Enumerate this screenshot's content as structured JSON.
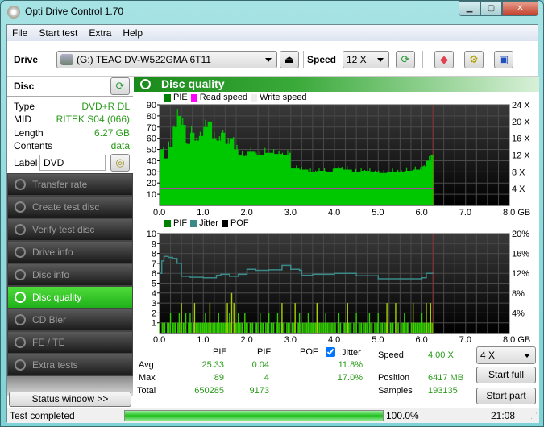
{
  "window": {
    "title": "Opti Drive Control 1.70",
    "minimize": "▁",
    "maximize": "▢",
    "close": "✕"
  },
  "menu": [
    "File",
    "Start test",
    "Extra",
    "Help"
  ],
  "toolbar": {
    "drive_label": "Drive",
    "drive_value": "(G:)  TEAC DV-W522GMA 6T11",
    "speed_label": "Speed",
    "speed_value": "12 X"
  },
  "disc": {
    "title": "Disc",
    "type_label": "Type",
    "type": "DVD+R DL",
    "mid_label": "MID",
    "mid": "RITEK S04 (066)",
    "length_label": "Length",
    "length": "6.27 GB",
    "contents_label": "Contents",
    "contents": "data",
    "label_label": "Label",
    "label": "DVD"
  },
  "nav": [
    "Transfer rate",
    "Create test disc",
    "Verify test disc",
    "Drive info",
    "Disc info",
    "Disc quality",
    "CD Bler",
    "FE / TE",
    "Extra tests"
  ],
  "nav_active": 5,
  "status_window": "Status window >>",
  "panel_title": "Disc quality",
  "colors": {
    "pie": "#00c800",
    "pif": "#33cc00",
    "jitter": "#3a8a8a",
    "read_speed": "#ff00ff",
    "end_marker": "#ff0000"
  },
  "chart_data": [
    {
      "type": "bar",
      "title": "PIE",
      "legend": [
        "PIE",
        "Read speed",
        "Write speed"
      ],
      "xlabel": "GB",
      "xlim": [
        0,
        8
      ],
      "xticks": [
        "0.0",
        "1.0",
        "2.0",
        "3.0",
        "4.0",
        "5.0",
        "6.0",
        "7.0",
        "8.0 GB"
      ],
      "ylim": [
        0,
        90
      ],
      "yticks": [
        "10",
        "20",
        "30",
        "40",
        "50",
        "60",
        "70",
        "80",
        "90"
      ],
      "y2ticks": [
        "4 X",
        "8 X",
        "12 X",
        "16 X",
        "20 X",
        "24 X"
      ],
      "y2lim": [
        0,
        24
      ],
      "x": [
        0,
        0.1,
        0.2,
        0.3,
        0.4,
        0.5,
        0.6,
        0.7,
        0.8,
        0.9,
        1.0,
        1.1,
        1.2,
        1.3,
        1.4,
        1.5,
        1.6,
        1.7,
        1.8,
        1.9,
        2.0,
        2.2,
        2.4,
        2.6,
        2.8,
        2.95,
        3.0,
        3.2,
        3.4,
        3.6,
        3.8,
        4.0,
        4.2,
        4.4,
        4.6,
        4.8,
        5.0,
        5.2,
        5.4,
        5.6,
        5.8,
        6.0,
        6.1,
        6.2,
        6.27
      ],
      "pie": [
        50,
        42,
        52,
        70,
        80,
        72,
        55,
        65,
        58,
        62,
        70,
        75,
        60,
        58,
        65,
        55,
        60,
        50,
        45,
        44,
        48,
        45,
        47,
        46,
        45,
        47,
        33,
        32,
        30,
        31,
        30,
        33,
        32,
        30,
        31,
        30,
        29,
        30,
        30,
        31,
        32,
        35,
        40,
        45,
        36
      ],
      "read_speed_x": 4,
      "end_gb": 6.27
    },
    {
      "type": "bar",
      "title": "PIF / Jitter",
      "legend": [
        "PIF",
        "Jitter",
        "POF"
      ],
      "xlim": [
        0,
        8
      ],
      "xticks": [
        "0.0",
        "1.0",
        "2.0",
        "3.0",
        "4.0",
        "5.0",
        "6.0",
        "7.0",
        "8.0 GB"
      ],
      "ylim": [
        0,
        10
      ],
      "yticks": [
        "1",
        "2",
        "3",
        "4",
        "5",
        "6",
        "7",
        "8",
        "9",
        "10"
      ],
      "y2ticks": [
        "4%",
        "8%",
        "12%",
        "16%",
        "20%"
      ],
      "y2lim": [
        0,
        20
      ],
      "jitter_x": [
        0,
        0.05,
        0.1,
        0.2,
        0.3,
        0.4,
        0.5,
        0.7,
        1.0,
        1.3,
        1.4,
        1.6,
        1.8,
        2.0,
        2.2,
        2.5,
        2.8,
        3.0,
        3.2,
        3.25,
        3.5,
        4.0,
        4.5,
        5.0,
        5.5,
        6.0,
        6.1,
        6.27
      ],
      "jitter": [
        12.0,
        14.5,
        15.4,
        15.2,
        15.0,
        14.0,
        11.4,
        11.2,
        11.1,
        11.6,
        11.8,
        11.4,
        11.8,
        12.8,
        12.6,
        12.7,
        13.6,
        12.8,
        12.6,
        11.6,
        11.8,
        12.0,
        11.5,
        10.9,
        10.9,
        11.1,
        12.0,
        12.2
      ],
      "pif_spikes": [
        [
          0.25,
          2
        ],
        [
          0.45,
          2
        ],
        [
          0.5,
          3
        ],
        [
          0.6,
          2
        ],
        [
          0.7,
          2
        ],
        [
          0.8,
          3
        ],
        [
          1.05,
          2
        ],
        [
          1.15,
          3
        ],
        [
          1.35,
          2
        ],
        [
          1.55,
          3
        ],
        [
          1.6,
          2
        ],
        [
          1.65,
          4
        ],
        [
          1.7,
          3
        ],
        [
          1.8,
          2
        ],
        [
          1.95,
          2
        ],
        [
          2.3,
          2
        ],
        [
          2.5,
          2
        ],
        [
          2.7,
          2
        ],
        [
          2.8,
          3
        ],
        [
          3.1,
          3
        ],
        [
          3.2,
          2
        ],
        [
          3.4,
          2
        ],
        [
          3.6,
          3
        ],
        [
          3.8,
          2
        ],
        [
          4.1,
          2
        ],
        [
          4.3,
          3
        ],
        [
          4.5,
          2
        ],
        [
          4.8,
          2
        ],
        [
          5.0,
          2
        ],
        [
          5.2,
          3
        ],
        [
          5.4,
          3
        ],
        [
          5.6,
          2
        ],
        [
          5.8,
          3
        ],
        [
          6.0,
          2
        ],
        [
          6.1,
          3
        ],
        [
          6.2,
          3
        ]
      ],
      "end_gb": 6.27
    }
  ],
  "stats": {
    "headers": [
      "PIE",
      "PIF",
      "POF",
      "Jitter"
    ],
    "jitter_checked": true,
    "avg_label": "Avg",
    "max_label": "Max",
    "total_label": "Total",
    "pie_avg": "25.33",
    "pif_avg": "0.04",
    "jitter_avg": "11.8%",
    "pie_max": "89",
    "pif_max": "4",
    "jitter_max": "17.0%",
    "pie_total": "650285",
    "pif_total": "9173"
  },
  "run": {
    "speed_label": "Speed",
    "speed": "4.00 X",
    "position_label": "Position",
    "position": "6417 MB",
    "samples_label": "Samples",
    "samples": "193135",
    "speed_select": "4 X",
    "start_full": "Start full",
    "start_part": "Start part"
  },
  "statusbar": {
    "text": "Test completed",
    "progress": 100,
    "percent": "100.0%",
    "time": "21:08"
  }
}
